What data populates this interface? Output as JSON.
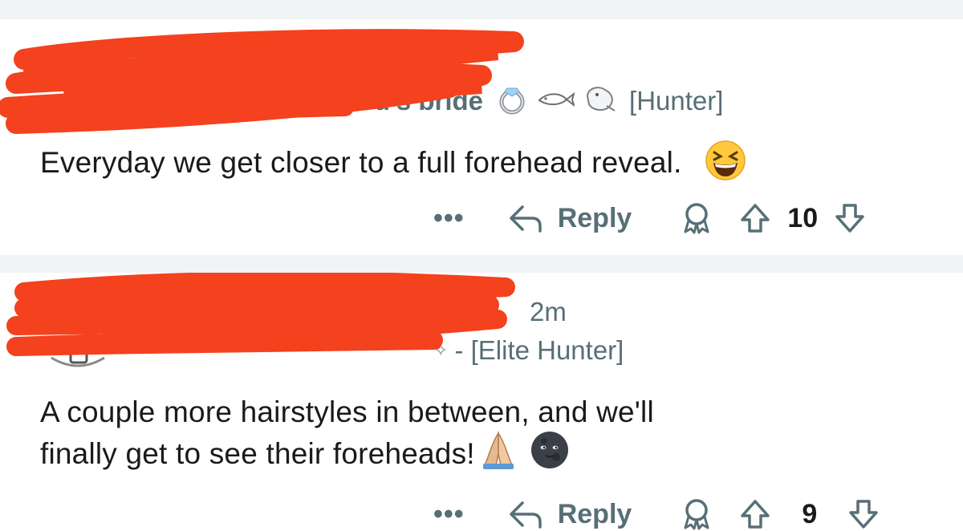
{
  "comments": [
    {
      "username_visible": "God's bride",
      "flair_text": "[Hunter]",
      "body": "Everyday we get closer to a full forehead reveal.",
      "body_emoji": "grinning-squinting-face",
      "actions": {
        "more": "•••",
        "reply": "Reply",
        "score": "10"
      }
    },
    {
      "timestamp": "2m",
      "flair_text": "- [Elite Hunter]",
      "body_line1": "A couple more hairstyles in between, and we'll",
      "body_line2": "finally get to see their foreheads!",
      "body_emojis": [
        "folded-hands",
        "new-moon-face"
      ],
      "actions": {
        "more": "•••",
        "reply": "Reply",
        "score": "9"
      }
    }
  ],
  "colors": {
    "redaction": "#f4411e",
    "meta_text": "#576f76",
    "body_text": "#1a1a1b",
    "separator": "#f2f3f5"
  },
  "icons": [
    "ring-icon",
    "fish-icon",
    "creature-icon",
    "reply-arrow-icon",
    "award-icon",
    "upvote-icon",
    "downvote-icon",
    "avatar-icon"
  ]
}
